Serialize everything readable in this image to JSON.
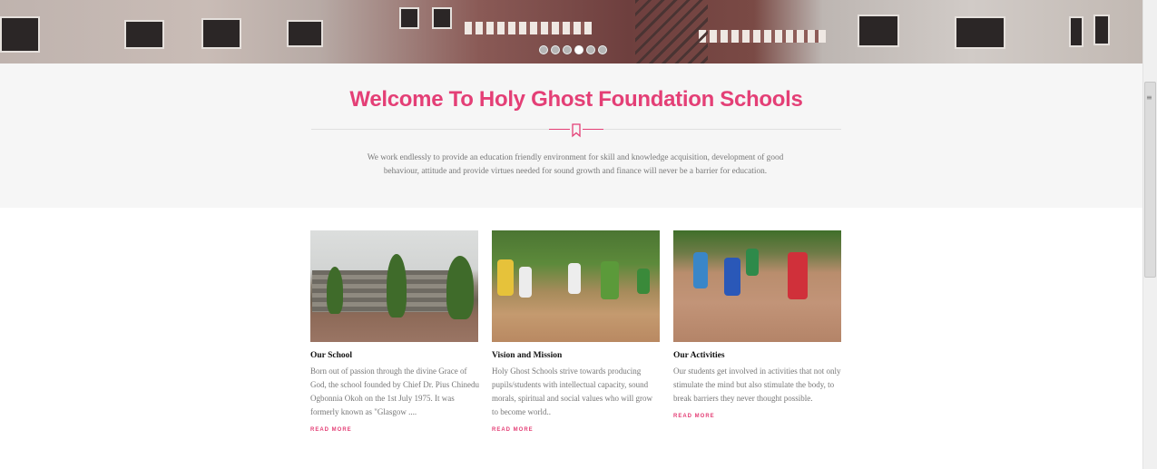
{
  "slider": {
    "dot_count": 6,
    "active_dot": 4
  },
  "welcome": {
    "title": "Welcome To Holy Ghost Foundation Schools",
    "intro": "We work endlessly to provide an education friendly environment for skill and knowledge acquisition, development of good behaviour, attitude and provide virtues needed for sound growth and finance will never be a barrier for education.",
    "divider_icon": "bookmark-icon"
  },
  "cards": [
    {
      "title": "Our School",
      "text": "Born out of passion through the divine Grace of God, the school founded by Chief Dr. Pius Chinedu Ogbonnia Okoh on the 1st July 1975. It was formerly known as \"Glasgow ....",
      "link": "READ MORE"
    },
    {
      "title": "Vision and Mission",
      "text": "Holy Ghost Schools strive towards producing pupils/students with intellectual capacity, sound morals, spiritual and social values who will grow to become world..",
      "link": "READ MORE"
    },
    {
      "title": "Our Activities",
      "text": "Our students get involved in activities that not only stimulate the mind but also stimulate the body, to break barriers they never thought possible.",
      "link": "READ MORE"
    }
  ],
  "colors": {
    "accent": "#e43f76",
    "section_bg": "#f6f6f6",
    "body_text": "#777777",
    "heading": "#111111"
  }
}
